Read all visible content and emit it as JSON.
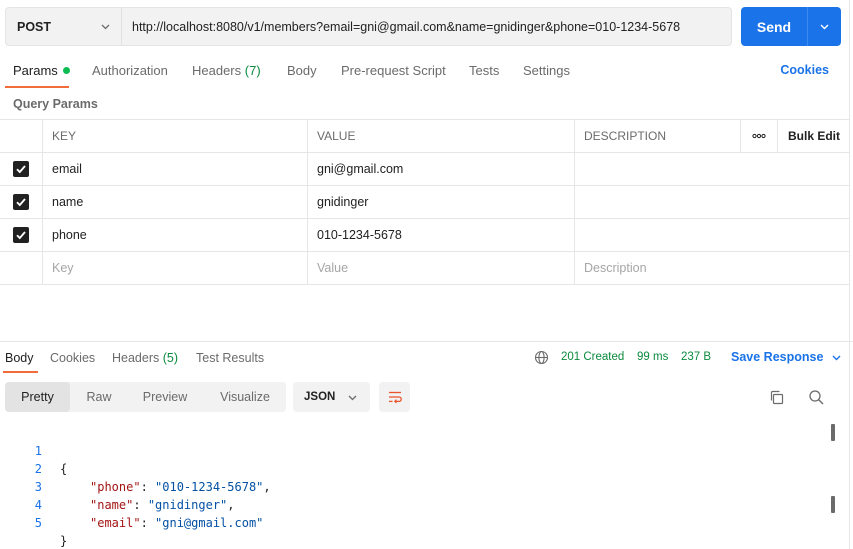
{
  "request": {
    "method": "POST",
    "url": "http://localhost:8080/v1/members?email=gni@gmail.com&name=gnidinger&phone=010-1234-5678",
    "send_label": "Send"
  },
  "req_tabs": {
    "params": "Params",
    "authorization": "Authorization",
    "headers": "Headers",
    "headers_count": "(7)",
    "body": "Body",
    "prerequest": "Pre-request Script",
    "tests": "Tests",
    "settings": "Settings",
    "cookies": "Cookies"
  },
  "query_params_label": "Query Params",
  "params_table": {
    "headers": {
      "key": "KEY",
      "value": "VALUE",
      "description": "DESCRIPTION",
      "more": "ooo",
      "bulk_edit": "Bulk Edit"
    },
    "rows": [
      {
        "key": "email",
        "value": "gni@gmail.com",
        "description": ""
      },
      {
        "key": "name",
        "value": "gnidinger",
        "description": ""
      },
      {
        "key": "phone",
        "value": "010-1234-5678",
        "description": ""
      }
    ],
    "placeholders": {
      "key": "Key",
      "value": "Value",
      "description": "Description"
    }
  },
  "resp_tabs": {
    "body": "Body",
    "cookies": "Cookies",
    "headers": "Headers",
    "headers_count": "(5)",
    "test_results": "Test Results"
  },
  "response_meta": {
    "status": "201 Created",
    "time": "99 ms",
    "size": "237 B",
    "save_response": "Save Response"
  },
  "format": {
    "pretty": "Pretty",
    "raw": "Raw",
    "preview": "Preview",
    "visualize": "Visualize",
    "language": "JSON"
  },
  "code": {
    "line_numbers": [
      "1",
      "2",
      "3",
      "4",
      "5"
    ],
    "open_brace": "{",
    "close_brace": "}",
    "entries": [
      {
        "key": "\"phone\"",
        "value": "\"010-1234-5678\"",
        "trail": ","
      },
      {
        "key": "\"name\"",
        "value": "\"gnidinger\"",
        "trail": ","
      },
      {
        "key": "\"email\"",
        "value": "\"gni@gmail.com\"",
        "trail": ""
      }
    ]
  },
  "colors": {
    "accent": "#1a73e8",
    "tab_underline": "#f26b3a",
    "status_green": "#0b8a3e"
  },
  "icons": [
    "chevron-down-icon",
    "checkbox-checked-icon",
    "globe-icon",
    "wrap-lines-icon",
    "copy-icon",
    "search-icon"
  ]
}
